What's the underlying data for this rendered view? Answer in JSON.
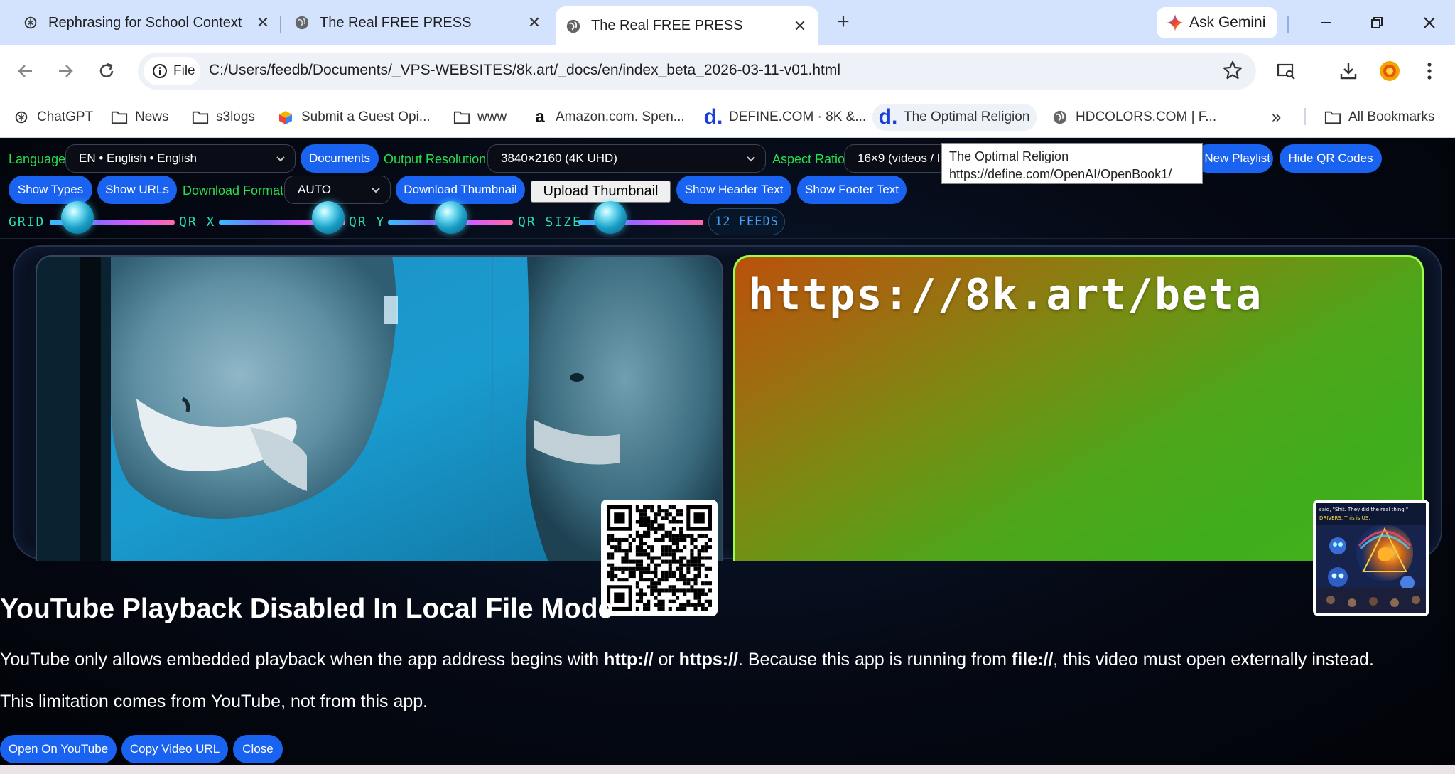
{
  "browser": {
    "tabs": [
      {
        "title": "Rephrasing for School Context",
        "active": false
      },
      {
        "title": "The Real FREE PRESS",
        "active": false
      },
      {
        "title": "The Real FREE PRESS",
        "active": true
      }
    ],
    "ask_gemini": "Ask Gemini",
    "file_chip": "File",
    "url": "C:/Users/feedb/Documents/_VPS-WEBSITES/8k.art/_docs/en/index_beta_2026-03-11-v01.html",
    "bookmarks": [
      {
        "label": "ChatGPT",
        "icon": "chatgpt-icon"
      },
      {
        "label": "News",
        "icon": "folder-icon"
      },
      {
        "label": "s3logs",
        "icon": "folder-icon"
      },
      {
        "label": "Submit a Guest Opi...",
        "icon": "colorful-cube-icon"
      },
      {
        "label": "www",
        "icon": "folder-icon"
      },
      {
        "label": "Amazon.com. Spen...",
        "icon": "amazon-icon"
      },
      {
        "label": "DEFINE.COM · 8K &...",
        "icon": "define-d-icon"
      },
      {
        "label": "The Optimal Religion",
        "icon": "define-d-icon"
      },
      {
        "label": "HDCOLORS.COM | F...",
        "icon": "globe-icon"
      }
    ],
    "more_bookmarks": "»",
    "all_bookmarks": "All Bookmarks",
    "tooltip": {
      "title": "The Optimal Religion",
      "url": "https://define.com/OpenAI/OpenBook1/"
    }
  },
  "controls": {
    "language_label": "Language",
    "language_value": "EN • English • English",
    "documents": "Documents",
    "output_resolution_label": "Output Resolution",
    "output_resolution_value": "3840×2160 (4K UHD)",
    "aspect_ratio_label": "Aspect Ratio",
    "aspect_ratio_value": "16×9 (videos / l",
    "new_playlist": "New Playlist",
    "hide_qr": "Hide QR Codes",
    "show_types": "Show Types",
    "show_urls": "Show URLs",
    "download_format_label": "Download Format",
    "download_format_value": "AUTO",
    "download_thumbnail": "Download Thumbnail",
    "upload_thumbnail": "Upload Thumbnail",
    "show_header_text": "Show Header Text",
    "show_footer_text": "Show Footer Text",
    "sliders": [
      {
        "label": "GRID"
      },
      {
        "label": "QR X"
      },
      {
        "label": "QR Y"
      },
      {
        "label": "QR SIZE"
      }
    ],
    "feeds": "12 FEEDS"
  },
  "cards": {
    "right_url": "https://8k.art/beta",
    "thumb_caption_1": "said, \"Shit. They did the real thing.\"",
    "thumb_caption_2": "DRIVERS. This is US."
  },
  "notice": {
    "title": "YouTube Playback Disabled In Local File Mode",
    "p1_a": "YouTube only allows embedded playback when the app address begins with ",
    "p1_b": "http://",
    "p1_c": " or ",
    "p1_d": "https://",
    "p1_e": ". Because this app is running from ",
    "p1_f": "file://",
    "p1_g": ", this video must open externally instead.",
    "p2": "This limitation comes from YouTube, not from this app.",
    "buttons": [
      "Open On YouTube",
      "Copy Video URL",
      "Close"
    ]
  },
  "colors": {
    "accent_blue": "#1a62f0",
    "label_green": "#27e04a",
    "slider_label": "#27e0b4"
  }
}
